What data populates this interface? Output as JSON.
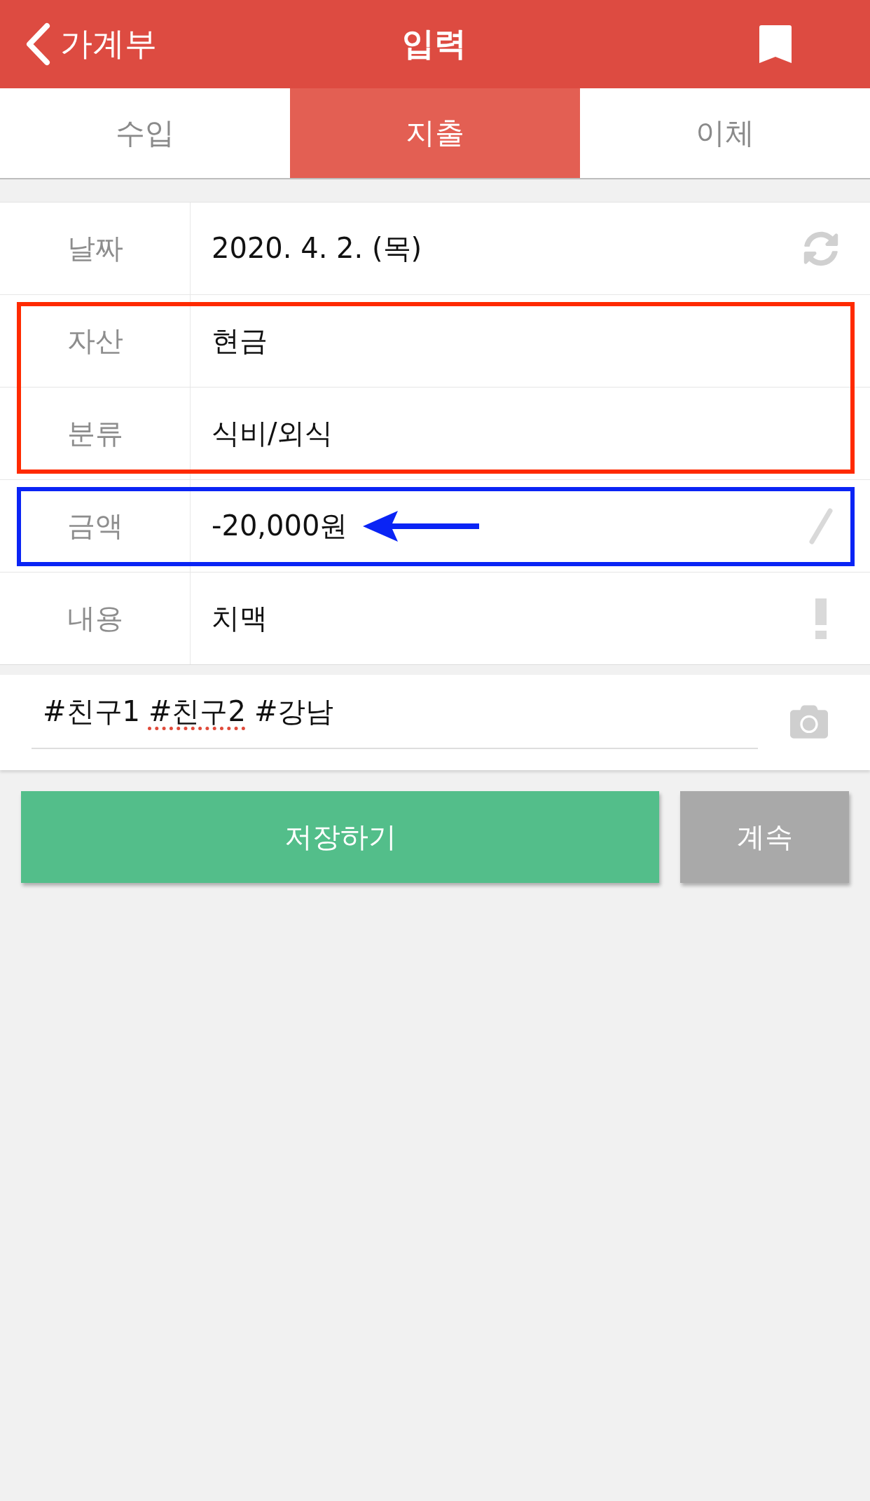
{
  "header": {
    "back_label": "가계부",
    "title": "입력"
  },
  "tabs": [
    {
      "label": "수입",
      "selected": false
    },
    {
      "label": "지출",
      "selected": true
    },
    {
      "label": "이체",
      "selected": false
    }
  ],
  "form_groups": [
    {
      "rows": [
        {
          "kind": "date",
          "label": "날짜",
          "value": "2020. 4. 2. (목)",
          "arrow": false
        }
      ]
    },
    {
      "color": "#ff2a00",
      "rows": [
        {
          "kind": "choice",
          "label": "자산",
          "value": "현금",
          "arrow": false
        },
        {
          "kind": "choice",
          "label": "분류",
          "value": "식비/외식",
          "arrow": false
        }
      ]
    },
    {
      "color": "#0a24f5",
      "rows": [
        {
          "kind": "amount",
          "label": "금액",
          "value": "-20,000원",
          "arrow": true
        }
      ]
    },
    {
      "rows": [
        {
          "kind": "memo",
          "label": "내용",
          "value": "치맥",
          "arrow": false
        }
      ]
    }
  ],
  "tags": [
    {
      "text": "#친구1",
      "spell_error": false
    },
    {
      "text": "#친구2",
      "spell_error": true
    },
    {
      "text": "#강남",
      "spell_error": false
    }
  ],
  "buttons": [
    {
      "kind": "save",
      "label": "저장하기"
    },
    {
      "kind": "continue",
      "label": "계속"
    }
  ]
}
